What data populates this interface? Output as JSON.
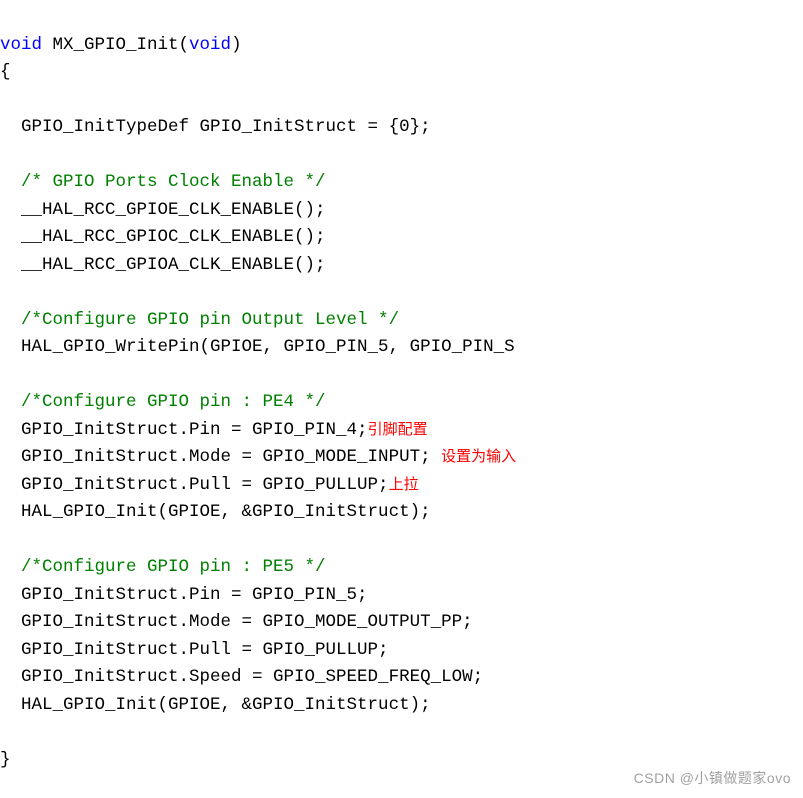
{
  "code": {
    "l1_kw1": "void",
    "l1_fn": " MX_GPIO_Init(",
    "l1_kw2": "void",
    "l1_close": ")",
    "l2": "{",
    "l3": "",
    "l4": "  GPIO_InitTypeDef GPIO_InitStruct = {",
    "l4_num": "0",
    "l4_end": "};",
    "l5": "",
    "l6": "  /* GPIO Ports Clock Enable */",
    "l7": "  __HAL_RCC_GPIOE_CLK_ENABLE();",
    "l8": "  __HAL_RCC_GPIOC_CLK_ENABLE();",
    "l9": "  __HAL_RCC_GPIOA_CLK_ENABLE();",
    "l10": "",
    "l11": "  /*Configure GPIO pin Output Level */",
    "l12": "  HAL_GPIO_WritePin(GPIOE, GPIO_PIN_5, GPIO_PIN_S",
    "l13": "",
    "l14": "  /*Configure GPIO pin : PE4 */",
    "l15a": "  GPIO_InitStruct.Pin = GPIO_PIN_4;",
    "l15b": "引脚配置",
    "l16a": "  GPIO_InitStruct.Mode = GPIO_MODE_INPUT; ",
    "l16b": "设置为输入",
    "l17a": "  GPIO_InitStruct.Pull = GPIO_PULLUP;",
    "l17b": "上拉",
    "l18": "  HAL_GPIO_Init(GPIOE, &GPIO_InitStruct);",
    "l19": "",
    "l20": "  /*Configure GPIO pin : PE5 */",
    "l21": "  GPIO_InitStruct.Pin = GPIO_PIN_5;",
    "l22": "  GPIO_InitStruct.Mode = GPIO_MODE_OUTPUT_PP;",
    "l23": "  GPIO_InitStruct.Pull = GPIO_PULLUP;",
    "l24": "  GPIO_InitStruct.Speed = GPIO_SPEED_FREQ_LOW;",
    "l25": "  HAL_GPIO_Init(GPIOE, &GPIO_InitStruct);",
    "l26": "",
    "l27": "}"
  },
  "gutter": {
    "brace_mark": "⌊"
  },
  "watermark": "CSDN @小镇做题家ovo"
}
